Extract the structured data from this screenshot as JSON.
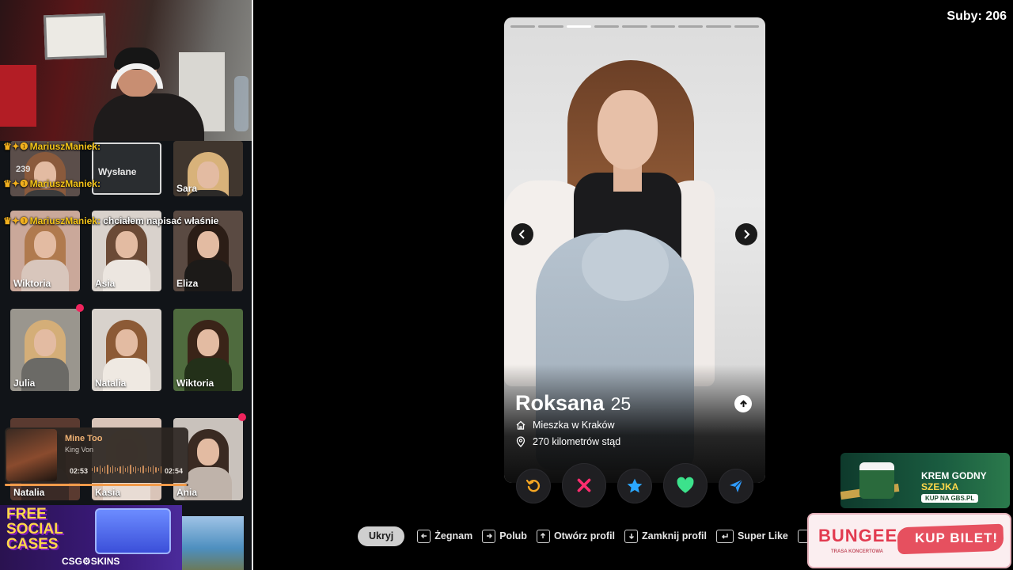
{
  "stream": {
    "subs_counter": "Suby: 206"
  },
  "chat": {
    "lines": [
      {
        "badges": "♛✦❶",
        "user": "MariuszManiek:",
        "msg": ""
      },
      {
        "badges": "♛✦❶",
        "user": "MariuszManiek:",
        "msg": ""
      },
      {
        "badges": "♛✦❶",
        "user": "MariuszManiek:",
        "msg": "chciałem napisać właśnie"
      }
    ]
  },
  "matches": {
    "sent_label": "Wysłane",
    "count_label": "239",
    "tiles": [
      {
        "name": "",
        "hair": "#8a5a3c",
        "bg": "#5b4e4a",
        "top": "#3b3b3b"
      },
      {
        "name": "Sara",
        "hair": "#d8b27a",
        "bg": "#40362e",
        "top": "#2c2a28"
      },
      {
        "name": "Wiktoria",
        "hair": "#b07a4e",
        "bg": "#caa89a",
        "top": "#d8c6bc"
      },
      {
        "name": "Asia",
        "hair": "#6b4a36",
        "bg": "#d9d2cc",
        "top": "#ece6e0"
      },
      {
        "name": "Eliza",
        "hair": "#2b1d16",
        "bg": "#5a4a42",
        "top": "#1c1a18"
      },
      {
        "name": "Julia",
        "hair": "#d4ae78",
        "bg": "#9a968e",
        "top": "#6b6a66"
      },
      {
        "name": "Natalia",
        "hair": "#8c5a36",
        "bg": "#d8d2cc",
        "top": "#efe9e2"
      },
      {
        "name": "Wiktoria",
        "hair": "#3a2418",
        "bg": "#4f6b3e",
        "top": "#233019"
      },
      {
        "name": "Natalia",
        "hair": "#2a1c16",
        "bg": "#5a3a30",
        "top": "#3a2a26"
      },
      {
        "name": "Kasia",
        "hair": "#e2c7a0",
        "bg": "#d9c4b8",
        "top": "#e8dcd4"
      },
      {
        "name": "Ania",
        "hair": "#3a2a22",
        "bg": "#c9c2bc",
        "top": "#bfb3aa"
      }
    ]
  },
  "music": {
    "title": "Mine Too",
    "artist": "King Von",
    "elapsed": "02:53",
    "duration": "02:54",
    "progress": 0.99
  },
  "banner_left": {
    "headline": "FREE SOCIAL CASES",
    "brand": "CSG⚙SKINS"
  },
  "profile": {
    "photo_count": 9,
    "active_photo": 3,
    "name": "Roksana",
    "age": "25",
    "lives_in": "Mieszka w Kraków",
    "distance": "270 kilometrów stąd"
  },
  "actions": {
    "rewind_color": "#f5a623",
    "nope_color": "#ff2d6f",
    "superlike_color": "#2ba8ff",
    "like_color": "#3ce28c",
    "boost_color": "#2e9bff"
  },
  "shortcuts": {
    "hide_label": "Ukryj",
    "items": [
      {
        "label": "Żegnam"
      },
      {
        "label": "Polub"
      },
      {
        "label": "Otwórz profil"
      },
      {
        "label": "Zamknij profil"
      },
      {
        "label": "Super Like"
      }
    ]
  },
  "ads": {
    "gbs_line1": "KREM GODNY",
    "gbs_line2": "SZEJKA",
    "gbs_cta": "KUP NA GBS.PL",
    "bungee_logo": "BUNGEE",
    "bungee_sub": "TRASA KONCERTOWA",
    "bungee_cta": "KUP BILET!"
  }
}
